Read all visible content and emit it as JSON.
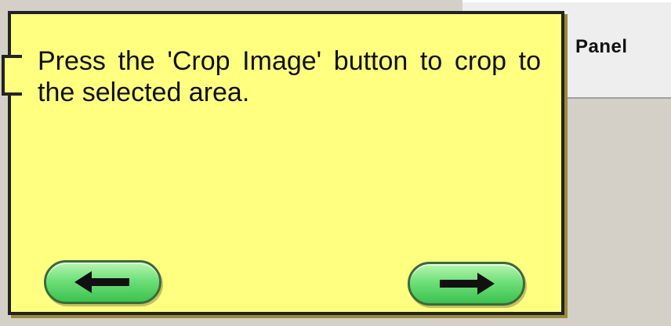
{
  "background": {
    "panel_label": "Panel"
  },
  "tooltip": {
    "message": "Press the 'Crop Image' button to crop to the selected area.",
    "prev_button_icon": "arrow-left-icon",
    "next_button_icon": "arrow-right-icon",
    "colors": {
      "fill": "#ffff80",
      "border": "#222222",
      "button": "#6fe07a"
    }
  }
}
